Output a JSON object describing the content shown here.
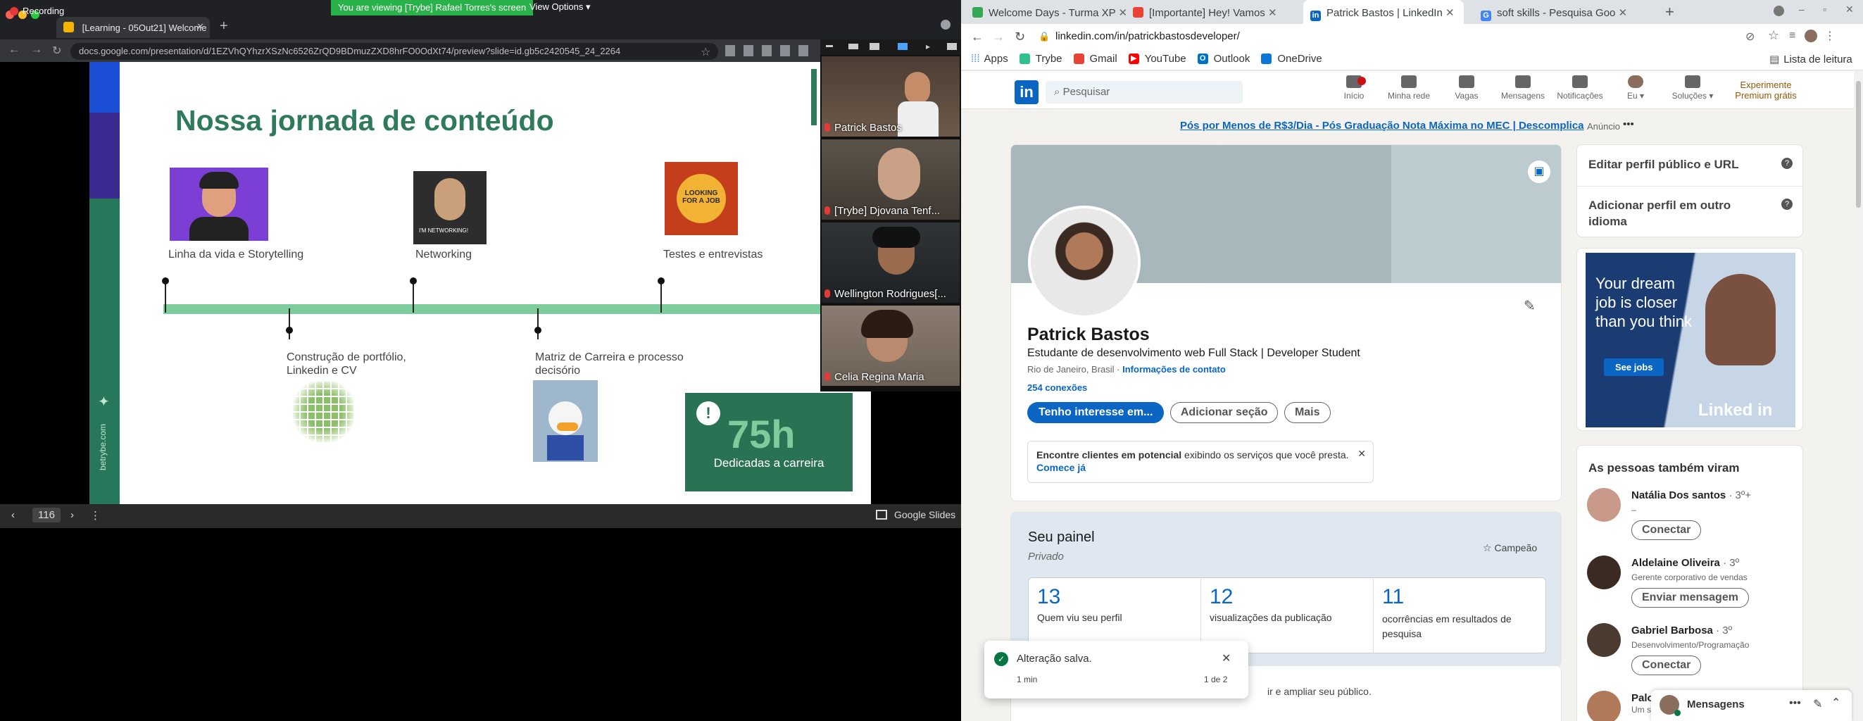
{
  "zoom": {
    "recording": "Recording",
    "banner": "You are viewing [Trybe] Rafael Torres's screen",
    "view_options": "View Options"
  },
  "left_browser": {
    "tab_title": "[Learning - 05Out21] Welcome",
    "url": "docs.google.com/presentation/d/1EZVhQYhzrXSzNc6526ZrQD9BDmuzZXD8hrFO0OdXt74/preview?slide=id.gb5c2420545_24_2264"
  },
  "slide": {
    "title": "Nossa jornada de conteúdo",
    "top_labels": [
      "Linha da vida e Storytelling",
      "Networking",
      "Testes e entrevistas"
    ],
    "bottom_labels": [
      "Construção de portfólio,\nLinkedin e CV",
      "Matriz de Carreira e processo\ndecisório"
    ],
    "networking_caption": "I'M NETWORKING!",
    "looking_badge": "LOOKING FOR A JOB",
    "card_number": "75h",
    "card_text": "Dedicadas a carreira",
    "side_brand": "betrybe.com",
    "page_number": "116",
    "footer_brand": "Google Slides"
  },
  "gallery": [
    {
      "name": "Patrick Bastos"
    },
    {
      "name": "[Trybe] Djovana Tenf..."
    },
    {
      "name": "Wellington Rodrigues[..."
    },
    {
      "name": "Celia Regina Maria"
    }
  ],
  "right_browser": {
    "tabs": [
      {
        "label": "Welcome Days - Turma XP",
        "color": "#34a853"
      },
      {
        "label": "[Importante] Hey! Vamos",
        "color": "#ea4335"
      },
      {
        "label": "Patrick Bastos | LinkedIn",
        "color": "#0a66c2"
      },
      {
        "label": "soft skills - Pesquisa Goo",
        "color": "#4285f4"
      }
    ],
    "url": "linkedin.com/in/patrickbastosdeveloper/",
    "bookmarks": [
      "Apps",
      "Trybe",
      "Gmail",
      "YouTube",
      "Outlook",
      "OneDrive"
    ],
    "reading_list": "Lista de leitura"
  },
  "linkedin": {
    "search_placeholder": "Pesquisar",
    "nav": [
      "Início",
      "Minha rede",
      "Vagas",
      "Mensagens",
      "Notificações",
      "Eu",
      "Soluções"
    ],
    "premium": "Experimente Premium grátis",
    "ad_text": "Pós por Menos de R$3/Dia - Pós Graduação Nota Máxima no MEC | Descomplica",
    "ad_tag": "Anúncio",
    "profile": {
      "name": "Patrick Bastos",
      "headline": "Estudante de desenvolvimento web Full Stack | Developer Student",
      "location": "Rio de Janeiro, Brasil",
      "contact": "Informações de contato",
      "connections": "254 conexões",
      "btn_interest": "Tenho interesse em...",
      "btn_section": "Adicionar seção",
      "btn_more": "Mais"
    },
    "promo": {
      "bold": "Encontre clientes em potencial",
      "text": " exibindo os serviços que você presta.",
      "link": "Comece já"
    },
    "sidebar": {
      "edit_url": "Editar perfil público e URL",
      "add_lang": "Adicionar perfil em outro idioma"
    },
    "ad_box": {
      "text": "Your dream job is closer than you think",
      "button": "See jobs",
      "logo": "Linked in"
    },
    "panel": {
      "title": "Seu painel",
      "subtitle": "Privado",
      "badge": "Campeão",
      "stats": [
        {
          "value": "13",
          "label": "Quem viu seu perfil"
        },
        {
          "value": "12",
          "label": "visualizações da publicação"
        },
        {
          "value": "11",
          "label": "ocorrências em resultados de pesquisa"
        }
      ]
    },
    "toast": {
      "text": "Alteração salva.",
      "time": "1 min",
      "count": "1 de 2"
    },
    "below_toast": "ir e ampliar seu público.",
    "people_title": "As pessoas também viram",
    "people": [
      {
        "name": "Natália Dos santos",
        "degree": "· 3º+",
        "headline": "–",
        "action": "Conectar"
      },
      {
        "name": "Aldelaine Oliveira",
        "degree": "· 3º",
        "headline": "Gerente corporativo de vendas",
        "action": "Enviar mensagem"
      },
      {
        "name": "Gabriel Barbosa",
        "degree": "· 3º",
        "headline": "Desenvolvimento/Programação",
        "action": "Conectar"
      },
      {
        "name": "Palo",
        "degree": "",
        "headline": "Um s",
        "action": ""
      }
    ],
    "messages": "Mensagens"
  }
}
